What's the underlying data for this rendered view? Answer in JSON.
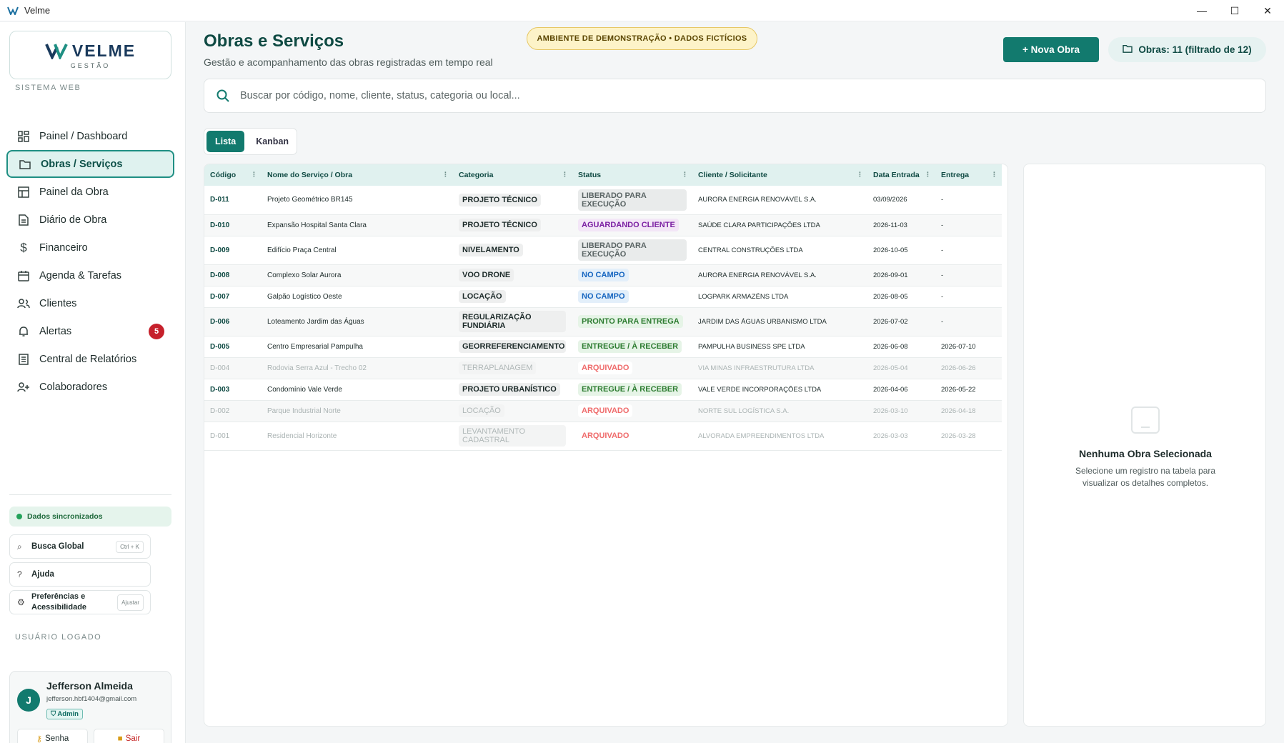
{
  "window": {
    "title": "Velme"
  },
  "brand": {
    "word": "VELME",
    "sub": "GESTÃO"
  },
  "sidebar": {
    "section_label": "SISTEMA WEB",
    "items": [
      {
        "label": "Painel / Dashboard",
        "icon": "dashboard-icon"
      },
      {
        "label": "Obras / Serviços",
        "icon": "folder-icon",
        "active": true
      },
      {
        "label": "Painel da Obra",
        "icon": "panel-icon"
      },
      {
        "label": "Diário de Obra",
        "icon": "document-icon"
      },
      {
        "label": "Financeiro",
        "icon": "dollar-icon"
      },
      {
        "label": "Agenda & Tarefas",
        "icon": "calendar-icon"
      },
      {
        "label": "Clientes",
        "icon": "users-icon"
      },
      {
        "label": "Alertas",
        "icon": "bell-icon",
        "badge": "5"
      },
      {
        "label": "Central de Relatórios",
        "icon": "report-icon"
      },
      {
        "label": "Colaboradores",
        "icon": "user-plus-icon"
      }
    ],
    "sync_status": "Dados sincronizados",
    "global_search": {
      "label": "Busca Global",
      "shortcut": "Ctrl + K"
    },
    "help": {
      "label": "Ajuda"
    },
    "prefs": {
      "label": "Preferências e Acessibilidade",
      "action": "Ajustar"
    },
    "user_section_label": "USUÁRIO LOGADO",
    "user": {
      "initial": "J",
      "name": "Jefferson Almeida",
      "email": "jefferson.hbf1404@gmail.com",
      "role": "Admin",
      "password_btn": "Senha",
      "logout_btn": "Sair"
    }
  },
  "header": {
    "title": "Obras e Serviços",
    "subtitle": "Gestão e acompanhamento das obras registradas em tempo real",
    "demo_badge": "AMBIENTE DE DEMONSTRAÇÃO • DADOS FICTÍCIOS",
    "new_button": "+ Nova Obra",
    "count": "Obras: 11 (filtrado de 12)"
  },
  "search": {
    "placeholder": "Buscar por código, nome, cliente, status, categoria ou local..."
  },
  "view_tabs": {
    "list": "Lista",
    "kanban": "Kanban"
  },
  "table": {
    "columns": [
      "Código",
      "Nome do Serviço / Obra",
      "Categoria",
      "Status",
      "Cliente / Solicitante",
      "Data Entrada",
      "Entrega"
    ],
    "rows": [
      {
        "code": "D-011",
        "name": "Projeto Geométrico BR145",
        "category": "PROJETO TÉCNICO",
        "status": "LIBERADO PARA EXECUÇÃO",
        "status_color": "#5a6464",
        "status_bg": "#e9ebeb",
        "client": "AURORA ENERGIA RENOVÁVEL S.A.",
        "entry": "03/09/2026",
        "delivery": "-",
        "muted": false
      },
      {
        "code": "D-010",
        "name": "Expansão Hospital Santa Clara",
        "category": "PROJETO TÉCNICO",
        "status": "AGUARDANDO CLIENTE",
        "status_color": "#7b1fa2",
        "status_bg": "#f3e6f7",
        "client": "SAÚDE CLARA PARTICIPAÇÕES LTDA",
        "entry": "2026-11-03",
        "delivery": "-",
        "muted": false
      },
      {
        "code": "D-009",
        "name": "Edifício Praça Central",
        "category": "NIVELAMENTO",
        "status": "LIBERADO PARA EXECUÇÃO",
        "status_color": "#5a6464",
        "status_bg": "#e9ebeb",
        "client": "CENTRAL CONSTRUÇÕES LTDA",
        "entry": "2026-10-05",
        "delivery": "-",
        "muted": false
      },
      {
        "code": "D-008",
        "name": "Complexo Solar Aurora",
        "category": "VOO DRONE",
        "status": "NO CAMPO",
        "status_color": "#1565c0",
        "status_bg": "#e3effa",
        "client": "AURORA ENERGIA RENOVÁVEL S.A.",
        "entry": "2026-09-01",
        "delivery": "-",
        "muted": false
      },
      {
        "code": "D-007",
        "name": "Galpão Logístico Oeste",
        "category": "LOCAÇÃO",
        "status": "NO CAMPO",
        "status_color": "#1565c0",
        "status_bg": "#e3effa",
        "client": "LOGPARK ARMAZÉNS LTDA",
        "entry": "2026-08-05",
        "delivery": "-",
        "muted": false
      },
      {
        "code": "D-006",
        "name": "Loteamento Jardim das Águas",
        "category": "REGULARIZAÇÃO FUNDIÁRIA",
        "status": "PRONTO PARA ENTREGA",
        "status_color": "#2e7d32",
        "status_bg": "#e6f4e7",
        "client": "JARDIM DAS ÁGUAS URBANISMO LTDA",
        "entry": "2026-07-02",
        "delivery": "-",
        "muted": false
      },
      {
        "code": "D-005",
        "name": "Centro Empresarial Pampulha",
        "category": "GEORREFERENCIAMENTO",
        "status": "ENTREGUE / À RECEBER",
        "status_color": "#2e7d32",
        "status_bg": "#e6f4e7",
        "client": "PAMPULHA BUSINESS SPE LTDA",
        "entry": "2026-06-08",
        "delivery": "2026-07-10",
        "muted": false
      },
      {
        "code": "D-004",
        "name": "Rodovia Serra Azul - Trecho 02",
        "category": "TERRAPLANAGEM",
        "status": "ARQUIVADO",
        "status_color": "#ef6b6b",
        "status_bg": "#fdeeee",
        "client": "VIA MINAS INFRAESTRUTURA LTDA",
        "entry": "2026-05-04",
        "delivery": "2026-06-26",
        "muted": true
      },
      {
        "code": "D-003",
        "name": "Condomínio Vale Verde",
        "category": "PROJETO URBANÍSTICO",
        "status": "ENTREGUE / À RECEBER",
        "status_color": "#2e7d32",
        "status_bg": "#e6f4e7",
        "client": "VALE VERDE INCORPORAÇÕES LTDA",
        "entry": "2026-04-06",
        "delivery": "2026-05-22",
        "muted": false
      },
      {
        "code": "D-002",
        "name": "Parque Industrial Norte",
        "category": "LOCAÇÃO",
        "status": "ARQUIVADO",
        "status_color": "#ef6b6b",
        "status_bg": "#fdeeee",
        "client": "NORTE SUL LOGÍSTICA S.A.",
        "entry": "2026-03-10",
        "delivery": "2026-04-18",
        "muted": true
      },
      {
        "code": "D-001",
        "name": "Residencial Horizonte",
        "category": "LEVANTAMENTO CADASTRAL",
        "status": "ARQUIVADO",
        "status_color": "#ef6b6b",
        "status_bg": "#fdeeee",
        "client": "ALVORADA EMPREENDIMENTOS LTDA",
        "entry": "2026-03-03",
        "delivery": "2026-03-28",
        "muted": true
      }
    ]
  },
  "detail": {
    "empty_title": "Nenhuma Obra Selecionada",
    "empty_text": "Selecione um registro na tabela para visualizar os detalhes completos."
  },
  "colors": {
    "accent": "#127a6e",
    "accent_dark": "#0f4a43",
    "alert": "#c6202b"
  }
}
